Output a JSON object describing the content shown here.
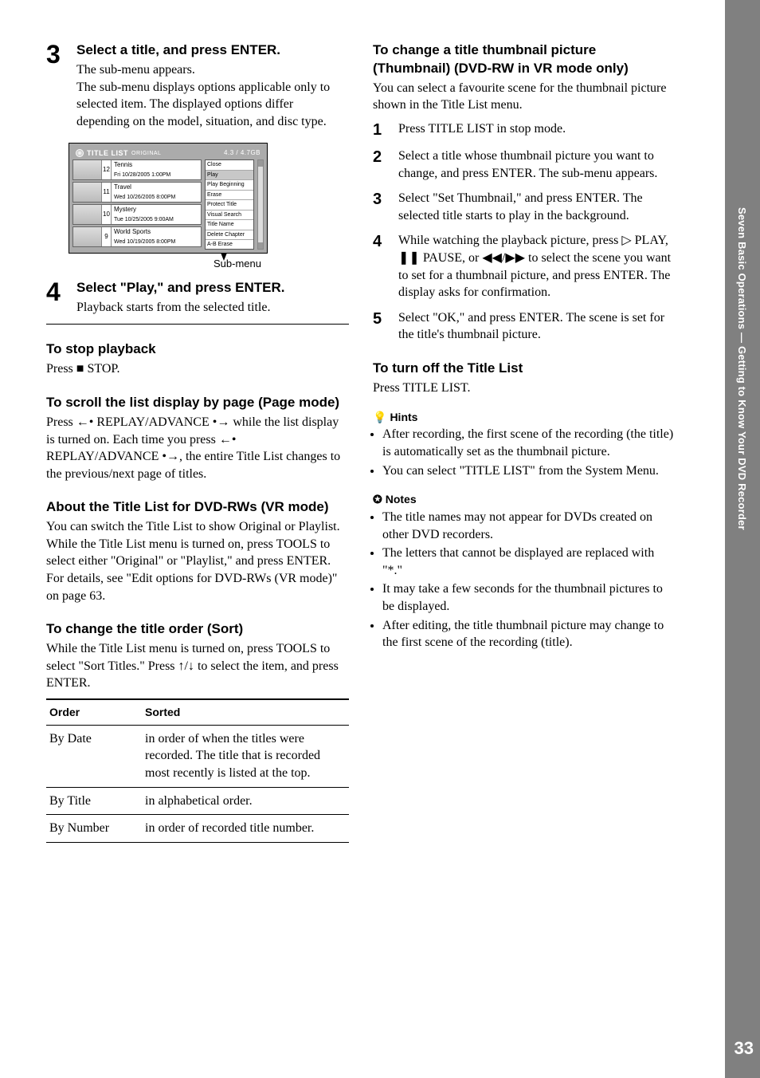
{
  "sidebar": {
    "chapter": "Seven Basic Operations — Getting to Know Your DVD Recorder",
    "page": "33"
  },
  "left": {
    "step3": {
      "num": "3",
      "head": "Select a title, and press ENTER.",
      "p1": "The sub-menu appears.",
      "p2": "The sub-menu displays options applicable only to selected item. The displayed options differ depending on the model, situation, and disc type."
    },
    "diagram": {
      "title": "TITLE LIST",
      "mode": "ORIGINAL",
      "capacity": "4.3 / 4.7GB",
      "rows": [
        {
          "num": "12",
          "title": "Tennis",
          "date": "Fri 10/28/2005 1:00PM"
        },
        {
          "num": "11",
          "title": "Travel",
          "date": "Wed 10/26/2005 8:00PM"
        },
        {
          "num": "10",
          "title": "Mystery",
          "date": "Tue 10/25/2005 9:00AM"
        },
        {
          "num": "9",
          "title": "World Sports",
          "date": "Wed 10/19/2005 8:00PM"
        }
      ],
      "submenu": [
        "Close",
        "Play",
        "Play Beginning",
        "Erase",
        "Protect Title",
        "Visual Search",
        "Title Name",
        "Delete Chapter",
        "A-B Erase"
      ],
      "label": "Sub-menu"
    },
    "step4": {
      "num": "4",
      "head": "Select \"Play,\" and press ENTER.",
      "p1": "Playback starts from the selected title."
    },
    "stop": {
      "h": "To stop playback",
      "p": "Press ■ STOP."
    },
    "scroll": {
      "h": "To scroll the list display by page (Page mode)",
      "p": "Press ←• REPLAY/ADVANCE •→ while the list display is turned on. Each time you press ←• REPLAY/ADVANCE •→, the entire Title List changes to the previous/next page of titles."
    },
    "about": {
      "h": "About the Title List for DVD-RWs (VR mode)",
      "p1": "You can switch the Title List to show Original or Playlist.",
      "p2": "While the Title List menu is turned on, press TOOLS to select either \"Original\" or \"Playlist,\" and press ENTER.",
      "p3": "For details, see \"Edit options for DVD-RWs (VR mode)\" on page 63."
    },
    "sort": {
      "h": "To change the title order (Sort)",
      "p": "While the Title List menu is turned on, press TOOLS to select \"Sort Titles.\" Press ↑/↓ to select the item, and press ENTER.",
      "table": {
        "h1": "Order",
        "h2": "Sorted",
        "rows": [
          {
            "a": "By Date",
            "b": "in order of when the titles were recorded. The title that is recorded most recently is listed at the top."
          },
          {
            "a": "By Title",
            "b": "in alphabetical order."
          },
          {
            "a": "By Number",
            "b": "in order of recorded title number."
          }
        ]
      }
    }
  },
  "right": {
    "thumb": {
      "h": "To change a title thumbnail picture (Thumbnail) (DVD-RW in VR mode only)",
      "p": "You can select a favourite scene for the thumbnail picture shown in the Title List menu.",
      "s1": "Press TITLE LIST in stop mode.",
      "s2": "Select a title whose thumbnail picture you want to change, and press ENTER. The sub-menu appears.",
      "s3": "Select \"Set Thumbnail,\" and press ENTER. The selected title starts to play in the background.",
      "s4": "While watching the playback picture, press ▷ PLAY, ❚❚ PAUSE, or ◀◀/▶▶ to select the scene you want to set for a thumbnail picture, and press ENTER. The display asks for confirmation.",
      "s5": "Select \"OK,\" and press ENTER. The scene is set for the title's thumbnail picture."
    },
    "turnoff": {
      "h": "To turn off the Title List",
      "p": "Press TITLE LIST."
    },
    "hints": {
      "label": "Hints",
      "items": [
        "After recording, the first scene of the recording (the title) is automatically set as the thumbnail picture.",
        "You can select \"TITLE LIST\" from the System Menu."
      ]
    },
    "notes": {
      "label": "Notes",
      "items": [
        "The title names may not appear for DVDs created on other DVD recorders.",
        "The letters that cannot be displayed are replaced with \"*.\"",
        "It may take a few seconds for the thumbnail pictures to be displayed.",
        "After editing, the title thumbnail picture may change to the first scene of the recording (title)."
      ]
    }
  }
}
